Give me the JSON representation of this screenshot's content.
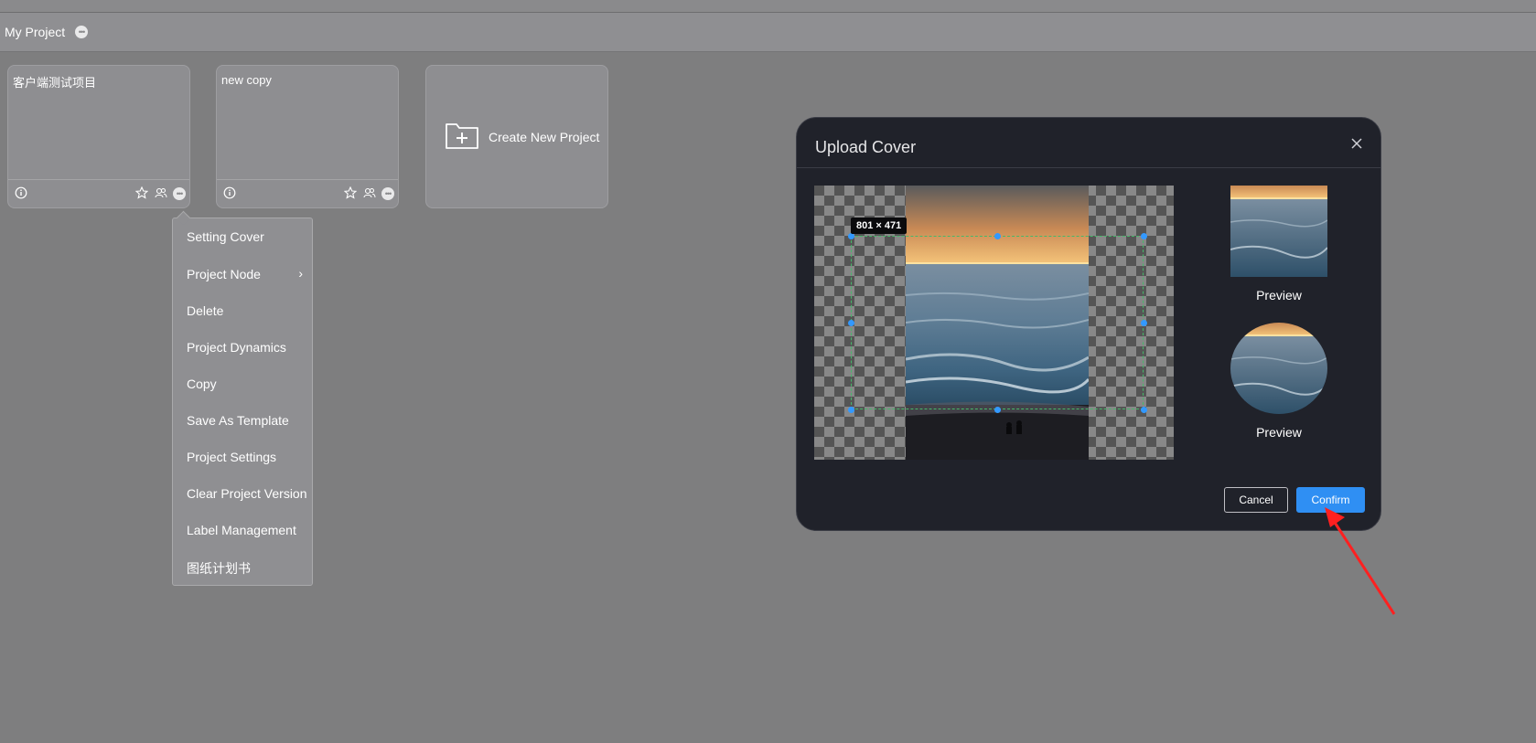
{
  "header": {
    "title": "My Project",
    "more_icon": "ellipsis-icon"
  },
  "projects": [
    {
      "name": "客户端测试项目"
    },
    {
      "name": "new copy"
    }
  ],
  "create_card": {
    "label": "Create New Project",
    "icon": "folder-plus-icon"
  },
  "context_menu": {
    "items": [
      "Setting Cover",
      "Project Node",
      "Delete",
      "Project Dynamics",
      "Copy",
      "Save As Template",
      "Project Settings",
      "Clear Project Version",
      "Label Management",
      "图纸计划书"
    ]
  },
  "dialog": {
    "title": "Upload Cover",
    "crop_size": "801 × 471",
    "preview_label": "Preview",
    "cancel_label": "Cancel",
    "confirm_label": "Confirm"
  },
  "colors": {
    "confirm": "#2f8ff3",
    "dialog_bg": "#20222a",
    "annotation_arrow": "#ff2020"
  }
}
